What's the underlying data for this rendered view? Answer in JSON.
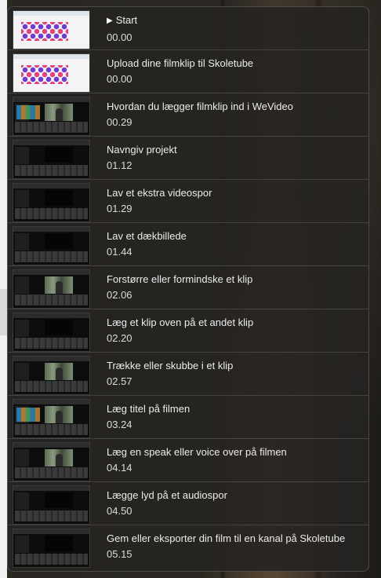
{
  "chapters": [
    {
      "title": "Start",
      "time": "00.00",
      "current": true,
      "thumb": "light"
    },
    {
      "title": "Upload dine filmklip til Skoletube",
      "time": "00.00",
      "thumb": "light"
    },
    {
      "title": "Hvordan du lægger filmklip ind i WeVideo",
      "time": "00.29",
      "thumb": "colors"
    },
    {
      "title": "Navngiv projekt",
      "time": "01.12",
      "thumb": "dark"
    },
    {
      "title": "Lav et ekstra videospor",
      "time": "01.29",
      "thumb": "dark"
    },
    {
      "title": "Lav et dækbillede",
      "time": "01.44",
      "thumb": "dark"
    },
    {
      "title": "Forstørre eller formindske et klip",
      "time": "02.06",
      "thumb": "photo"
    },
    {
      "title": "Læg et klip oven på et andet klip",
      "time": "02.20",
      "thumb": "dark"
    },
    {
      "title": "Trække eller skubbe i et klip",
      "time": "02.57",
      "thumb": "photo"
    },
    {
      "title": "Læg titel på filmen",
      "time": "03.24",
      "thumb": "colors-photo"
    },
    {
      "title": "Læg en speak eller voice over på filmen",
      "time": "04.14",
      "thumb": "photo"
    },
    {
      "title": "Lægge lyd på et audiospor",
      "time": "04.50",
      "thumb": "dark"
    },
    {
      "title": "Gem eller eksporter din film til en kanal på Skoletube",
      "time": "05.15",
      "thumb": "dark"
    }
  ],
  "current_marker_icon": "play-triangle-icon"
}
